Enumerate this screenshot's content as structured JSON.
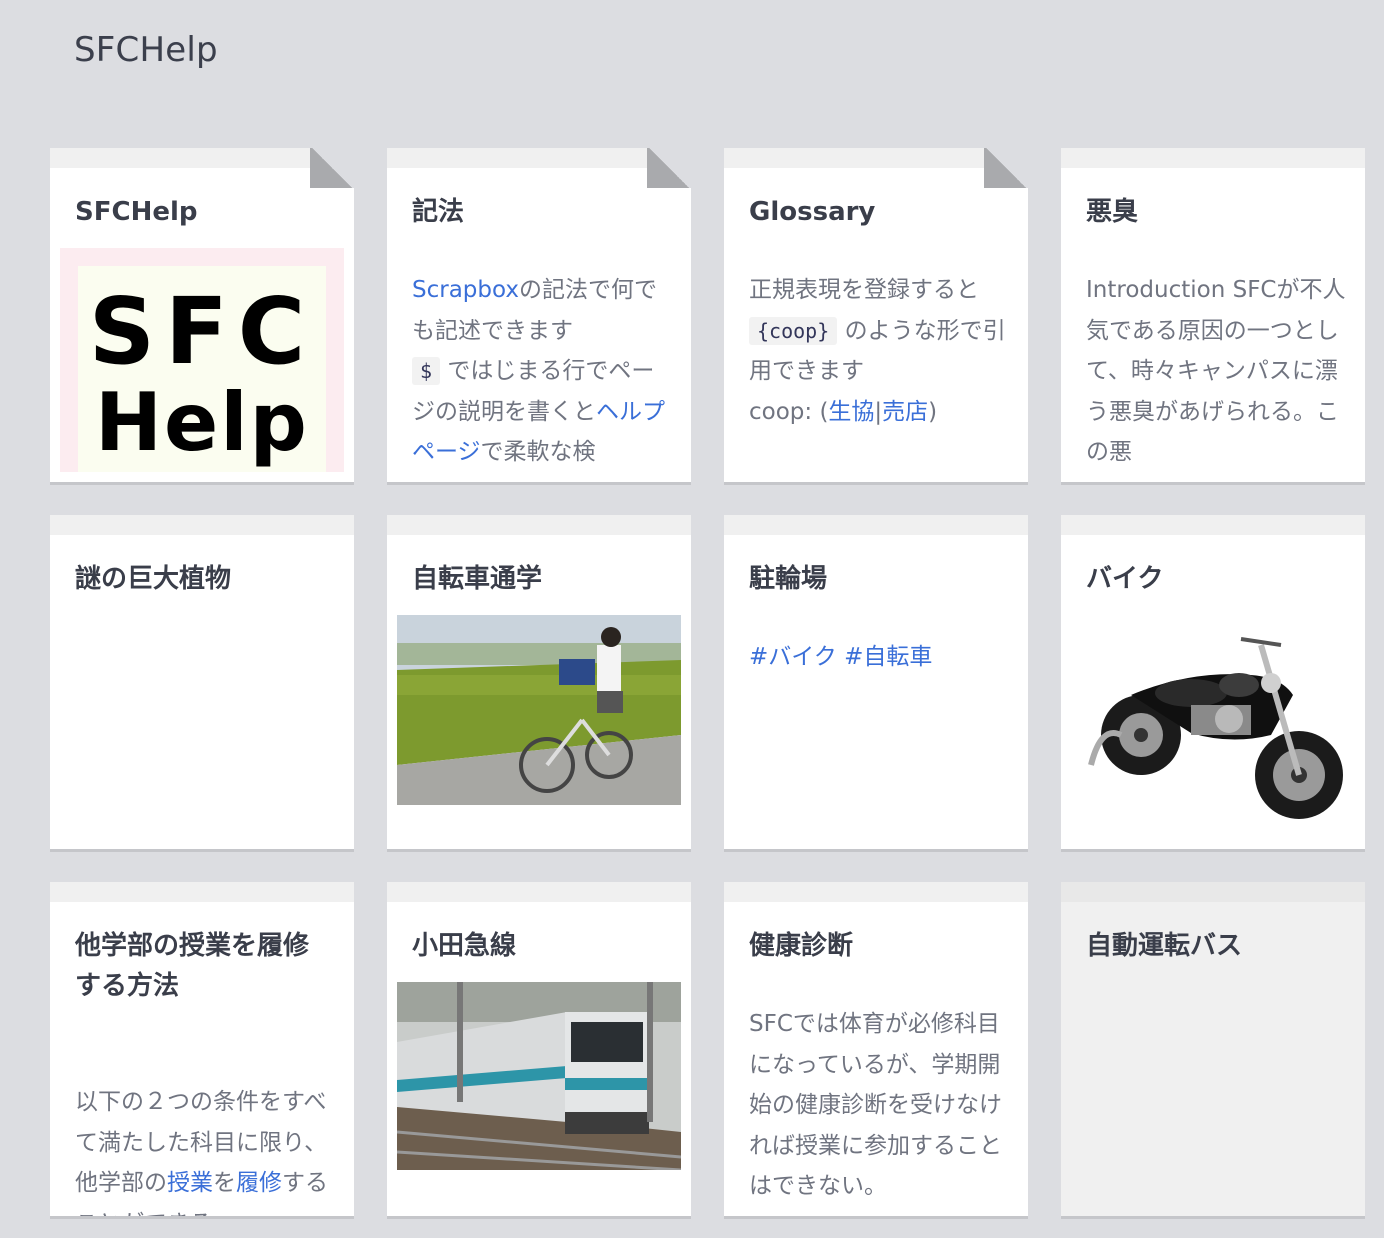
{
  "project": {
    "title": "SFCHelp"
  },
  "cards": {
    "c1": {
      "title": "SFCHelp",
      "logo_line1": "SFC",
      "logo_line2": "Help"
    },
    "c2": {
      "title": "記法",
      "link1": "Scrapbox",
      "text1": "の記法で何でも記述できます",
      "code": "$",
      "text2": "ではじまる行でページの説明を書くと",
      "link2": "ヘルプページ",
      "text3": "で柔軟な検"
    },
    "c3": {
      "title": "Glossary",
      "text1": "正規表現を登録すると",
      "code": "{coop}",
      "text2": "のような形で引用できます",
      "text3": "coop: (",
      "link1": "生協",
      "sep": "|",
      "link2": "売店",
      "text4": ")"
    },
    "c4": {
      "title": "悪臭",
      "body": "Introduction SFCが不人気である原因の一つとして、時々キャンパスに漂う悪臭があげられる。この悪"
    },
    "c5": {
      "title": "謎の巨大植物"
    },
    "c6": {
      "title": "自転車通学"
    },
    "c7": {
      "title": "駐輪場",
      "tag1": "#バイク",
      "tag2": "#自転車"
    },
    "c8": {
      "title": "バイク"
    },
    "c9": {
      "title": "他学部の授業を履修する方法",
      "text1": "以下の２つの条件をすべて満たした科目に限り、他学部の",
      "link1": "授業",
      "text2": "を",
      "link2": "履修",
      "text3": "することができる。"
    },
    "c10": {
      "title": "小田急線"
    },
    "c11": {
      "title": "健康診断",
      "body": "SFCでは体育が必修科目になっているが、学期開始の健康診断を受けなければ授業に参加することはできない。"
    },
    "c12": {
      "title": "自動運転バス"
    }
  },
  "colors": {
    "background": "#dcdde1",
    "link": "#3a6fd8",
    "title": "#3a3e4a",
    "body": "#707480"
  }
}
